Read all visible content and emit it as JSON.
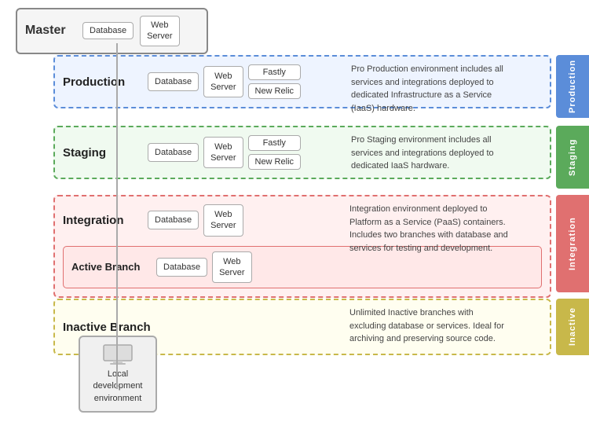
{
  "master": {
    "label": "Master",
    "services": [
      "Database",
      "Web\nServer"
    ]
  },
  "production": {
    "title": "Production",
    "services": [
      "Database",
      "Web\nServer"
    ],
    "extras": [
      "Fastly",
      "New Relic"
    ],
    "description": "Pro Production environment includes all services and integrations deployed to dedicated Infrastructure as a Service (IaaS) hardware.",
    "sidebar": "Production"
  },
  "staging": {
    "title": "Staging",
    "services": [
      "Database",
      "Web\nServer"
    ],
    "extras": [
      "Fastly",
      "New Relic"
    ],
    "description": "Pro Staging environment includes all services and integrations deployed to dedicated IaaS hardware.",
    "sidebar": "Staging"
  },
  "integration": {
    "title": "Integration",
    "services": [
      "Database",
      "Web\nServer"
    ],
    "description": "Integration environment deployed to Platform as a Service (PaaS) containers. Includes two branches with database and services for testing and development.",
    "sidebar": "Integration",
    "active_branch": {
      "title": "Active Branch",
      "services": [
        "Database",
        "Web\nServer"
      ]
    }
  },
  "inactive": {
    "title": "Inactive Branch",
    "description": "Unlimited Inactive branches with excluding database or services. Ideal for archiving and preserving source code.",
    "sidebar": "Inactive"
  },
  "local": {
    "label": "Local\ndevelopment\nenvironment"
  },
  "sidebar_labels": {
    "production": "Production",
    "staging": "Staging",
    "integration": "Integration",
    "inactive": "Inactive"
  }
}
